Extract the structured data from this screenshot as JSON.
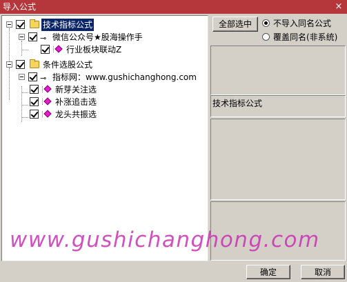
{
  "window": {
    "title": "导入公式",
    "close_glyph": "×"
  },
  "tree": {
    "group1": {
      "label": "技术指标公式",
      "sub": {
        "label": "微信公众号★股海操作手",
        "items": [
          {
            "label": "行业板块联动Z"
          }
        ]
      }
    },
    "group2": {
      "label": "条件选股公式",
      "sub": {
        "label": "指标网：www.gushichanghong.com",
        "items": [
          {
            "label": "新芽关注选"
          },
          {
            "label": "补涨追击选"
          },
          {
            "label": "龙头共振选"
          }
        ]
      }
    }
  },
  "right": {
    "select_all_label": "全部选中",
    "radio_skip_label": "不导入同名公式",
    "radio_overwrite_label": "覆盖同名(非系统)",
    "radio_selected": "skip",
    "panel_title": "技术指标公式"
  },
  "footer": {
    "ok_label": "确定",
    "cancel_label": "取消"
  },
  "watermark": "www.gushichanghong.com",
  "colors": {
    "titlebar": "#b5373b",
    "selection": "#0a246a",
    "watermark": "#c832b4"
  }
}
